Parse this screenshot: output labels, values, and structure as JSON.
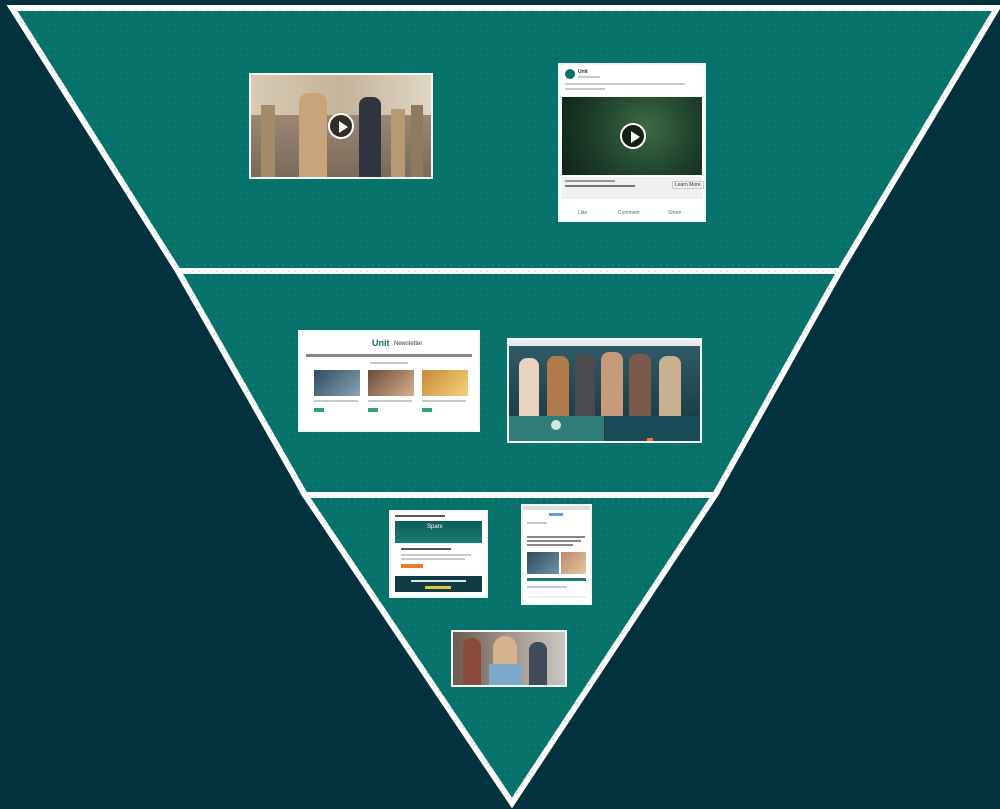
{
  "funnel": {
    "background_color": "#03313d",
    "tier_color": "#06726a",
    "border_color": "#ffffff",
    "tiers": [
      {
        "name": "top",
        "items": [
          "video-still-people-walking",
          "social-media-video-post"
        ]
      },
      {
        "name": "middle",
        "items": [
          "newsletter-webpage",
          "website-hero-group-photo"
        ]
      },
      {
        "name": "bottom",
        "items": [
          "email-screenshot",
          "mobile-article-screenshot",
          "office-photo"
        ]
      }
    ]
  },
  "thumbs": {
    "social_post": {
      "author": "Unit",
      "like": "Like",
      "comment": "Comment",
      "share": "Share",
      "cta": "Learn More"
    },
    "newsletter": {
      "logo": "Unit",
      "title": "Newsletter"
    },
    "email": {
      "header": "Sparx"
    }
  }
}
